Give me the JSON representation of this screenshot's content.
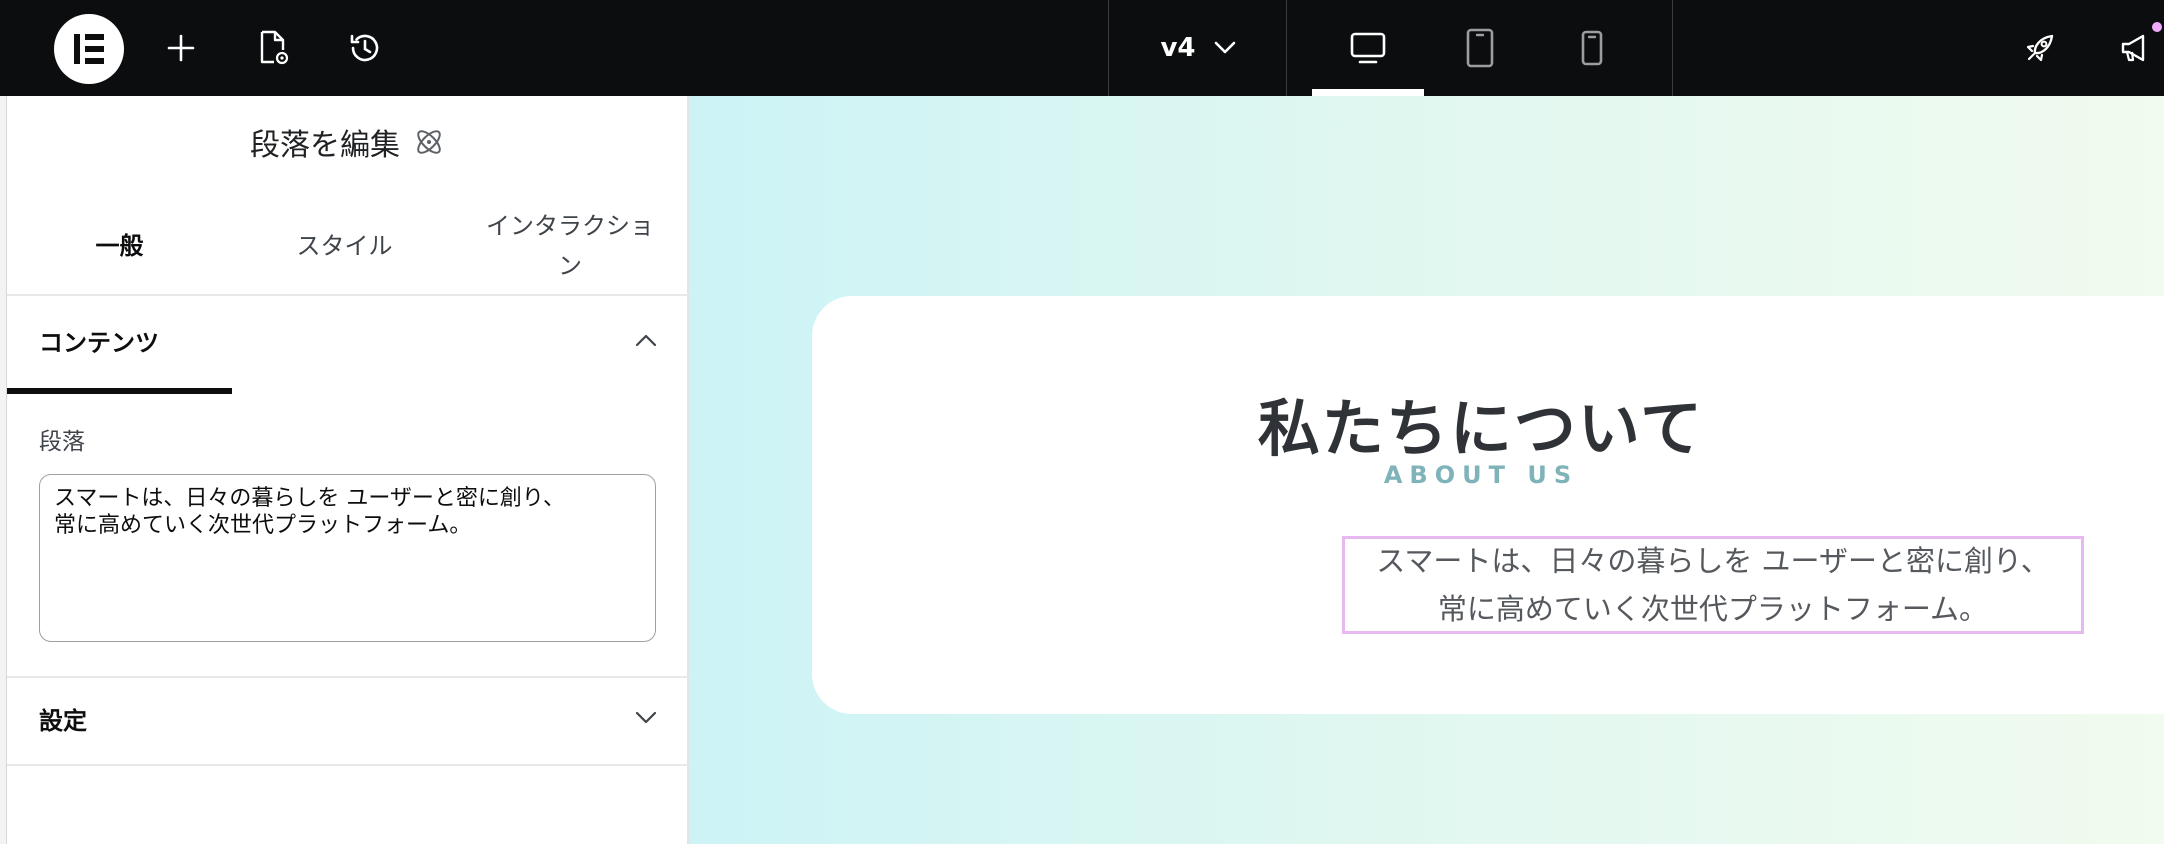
{
  "topbar": {
    "version_label": "v4",
    "icons": {
      "logo": "elementor-logo-icon",
      "add": "plus-icon",
      "page_settings": "page-settings-icon",
      "history": "history-icon",
      "version_dropdown": "chevron-down-icon",
      "desktop": "desktop-icon",
      "tablet": "tablet-icon",
      "mobile": "mobile-icon",
      "publish": "rocket-icon",
      "notifications": "megaphone-icon"
    },
    "notification_color": "#f0abfc"
  },
  "panel": {
    "title": "段落を編集",
    "title_icon": "atomic-icon",
    "tabs": [
      {
        "label": "一般",
        "active": true
      },
      {
        "label": "スタイル",
        "active": false
      },
      {
        "label": "インタラクション",
        "active": false
      }
    ],
    "sections": {
      "content": {
        "label": "コンテンツ",
        "expanded": true
      },
      "settings": {
        "label": "設定",
        "expanded": false
      }
    },
    "paragraph_field": {
      "label": "段落",
      "value": "スマートは、日々の暮らしを ユーザーと密に創り、\n常に高めていく次世代プラットフォーム。"
    }
  },
  "canvas": {
    "heading": "私たちについて",
    "subheading": "ABOUT US",
    "paragraph_line1": "スマートは、日々の暮らしを ユーザーと密に創り、",
    "paragraph_line2": "常に高めていく次世代プラットフォーム。",
    "selection_color": "#e8b8f0",
    "accent_color": "#7fb3ba"
  }
}
